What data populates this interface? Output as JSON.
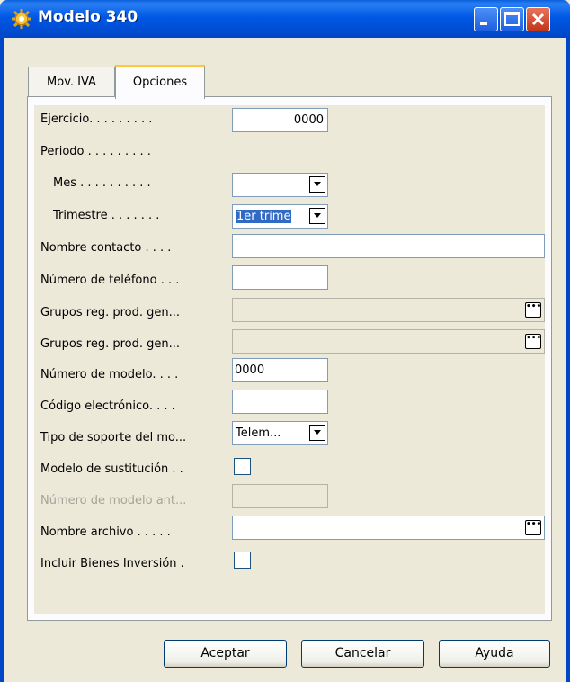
{
  "window": {
    "title": "Modelo 340",
    "icon": "gear-icon"
  },
  "tabs": [
    {
      "label": "Mov. IVA",
      "active": false
    },
    {
      "label": "Opciones",
      "active": true
    }
  ],
  "form": {
    "ejercicio": {
      "label": "Ejercicio. . . . . . . . .",
      "value": "0000"
    },
    "periodo": {
      "label": "Periodo . . . . . . . . ."
    },
    "mes": {
      "label": "Mes . . . . . . . . . .",
      "value": ""
    },
    "trimestre": {
      "label": "Trimestre . . . . . . .",
      "value": "1er trime"
    },
    "nombre_contacto": {
      "label": "Nombre contacto . . . .",
      "value": ""
    },
    "telefono": {
      "label": "Número de teléfono . . .",
      "value": ""
    },
    "grupos1": {
      "label": "Grupos reg. prod. gen...",
      "value": ""
    },
    "grupos2": {
      "label": "Grupos reg. prod. gen...",
      "value": ""
    },
    "numero_modelo": {
      "label": "Número de modelo. . . .",
      "value": "0000"
    },
    "codigo_electronico": {
      "label": "Código electrónico. . . .",
      "value": ""
    },
    "tipo_soporte": {
      "label": "Tipo de soporte del mo...",
      "value": "Telem..."
    },
    "modelo_sustitucion": {
      "label": "Modelo de sustitución . .",
      "checked": false
    },
    "numero_modelo_ant": {
      "label": "Número de modelo ant...",
      "value": ""
    },
    "nombre_archivo": {
      "label": "Nombre archivo . . . . .",
      "value": ""
    },
    "incluir_bienes": {
      "label": "Incluir Bienes Inversión .",
      "checked": false
    }
  },
  "buttons": {
    "accept": "Aceptar",
    "cancel": "Cancelar",
    "help": "Ayuda"
  },
  "colors": {
    "titlebar": "#0058E6",
    "background": "#ECE9D8",
    "selection": "#316AC5",
    "tab_accent": "#FFC83C"
  }
}
